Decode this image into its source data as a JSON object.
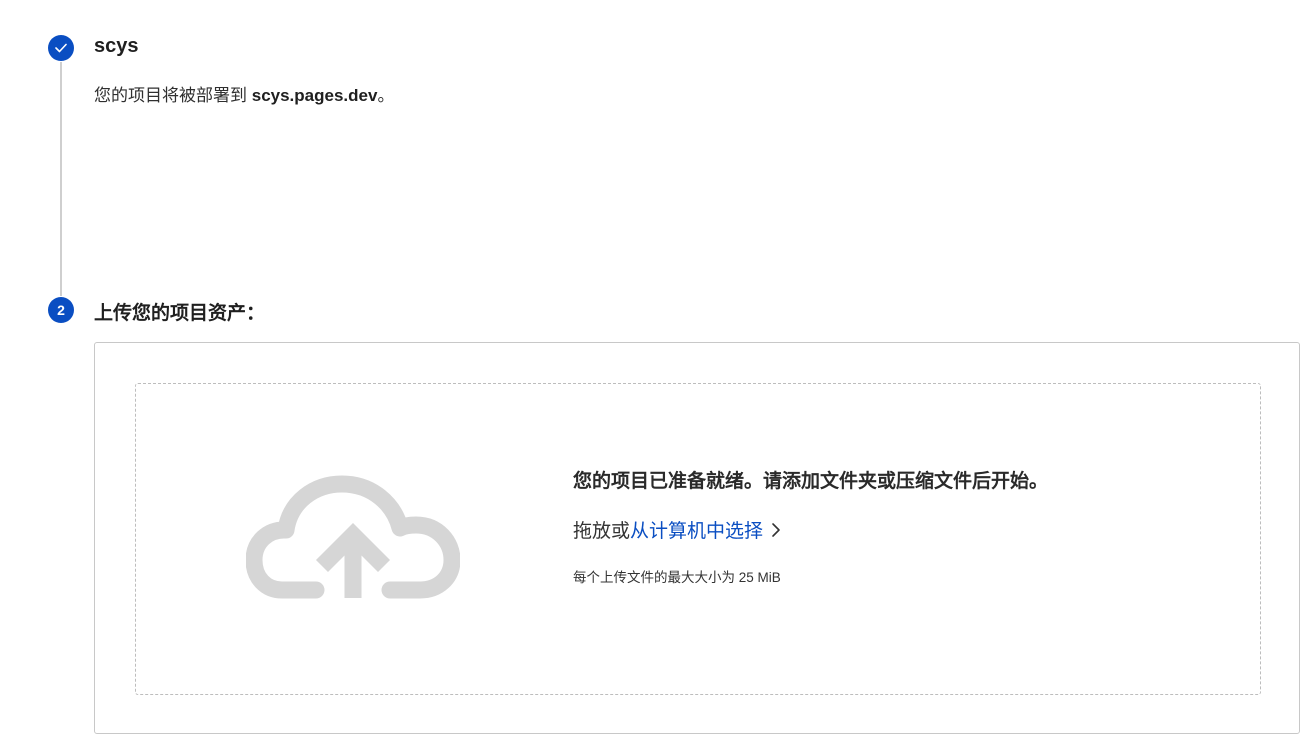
{
  "step1": {
    "number_icon": "checkmark-icon",
    "title": "scys",
    "deploy_prefix": "您的项目将被部署到 ",
    "deploy_domain": "scys.pages.dev",
    "deploy_suffix": "。"
  },
  "step2": {
    "number": "2",
    "title": "上传您的项目资产："
  },
  "upload": {
    "icon": "cloud-upload-icon",
    "headline": "您的项目已准备就绪。请添加文件夹或压缩文件后开始。",
    "action_prefix": "拖放或",
    "action_link": "从计算机中选择",
    "action_icon": "chevron-right-icon",
    "limit_text": "每个上传文件的最大大小为 25 MiB"
  },
  "colors": {
    "accent": "#0a4ec2",
    "icon_gray": "#d6d6d6",
    "timeline": "#cfcfcf"
  }
}
